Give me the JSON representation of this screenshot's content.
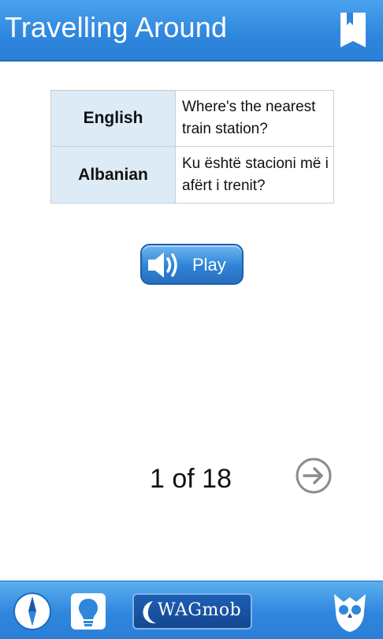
{
  "header": {
    "title": "Travelling Around",
    "menu_icon": "book-icon"
  },
  "phrase": {
    "rows": [
      {
        "language": "English",
        "text": "Where's the nearest train station?"
      },
      {
        "language": "Albanian",
        "text": "Ku është stacioni më i afërt i trenit?"
      }
    ]
  },
  "play": {
    "label": "Play",
    "icon": "speaker-icon"
  },
  "pagination": {
    "counter": "1 of 18",
    "current": 1,
    "total": 18,
    "next_icon": "arrow-right-circle-icon"
  },
  "footer": {
    "buttons": [
      {
        "icon": "compass-icon"
      },
      {
        "icon": "lightbulb-icon"
      },
      {
        "label": "WAGmob",
        "icon": "moon-icon"
      },
      {
        "icon": "owl-icon"
      }
    ]
  },
  "colors": {
    "header": "#2f86dd",
    "table_header_bg": "#dcebf6",
    "button_blue": "#2f83d6"
  }
}
